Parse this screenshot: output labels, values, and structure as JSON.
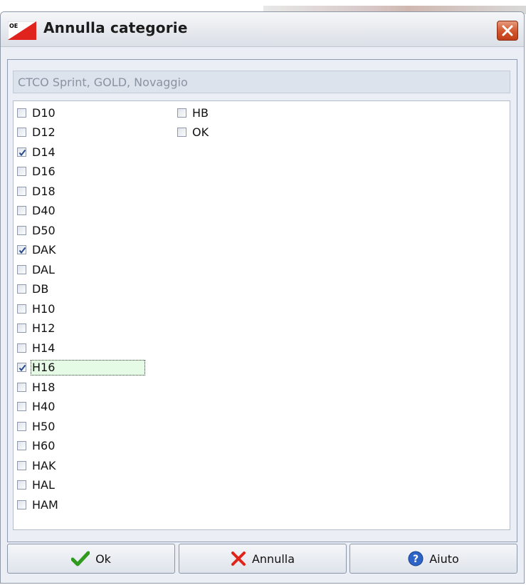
{
  "dialog": {
    "title": "Annulla categorie",
    "header": "CTCO Sprint, GOLD, Novaggio"
  },
  "categories": [
    {
      "label": "D10",
      "checked": false
    },
    {
      "label": "D12",
      "checked": false
    },
    {
      "label": "D14",
      "checked": true
    },
    {
      "label": "D16",
      "checked": false
    },
    {
      "label": "D18",
      "checked": false
    },
    {
      "label": "D40",
      "checked": false
    },
    {
      "label": "D50",
      "checked": false
    },
    {
      "label": "DAK",
      "checked": true
    },
    {
      "label": "DAL",
      "checked": false
    },
    {
      "label": "DB",
      "checked": false
    },
    {
      "label": "H10",
      "checked": false
    },
    {
      "label": "H12",
      "checked": false
    },
    {
      "label": "H14",
      "checked": false
    },
    {
      "label": "H16",
      "checked": true,
      "focused": true
    },
    {
      "label": "H18",
      "checked": false
    },
    {
      "label": "H40",
      "checked": false
    },
    {
      "label": "H50",
      "checked": false
    },
    {
      "label": "H60",
      "checked": false
    },
    {
      "label": "HAK",
      "checked": false
    },
    {
      "label": "HAL",
      "checked": false
    },
    {
      "label": "HAM",
      "checked": false
    },
    {
      "label": "HB",
      "checked": false
    },
    {
      "label": "OK",
      "checked": false
    }
  ],
  "buttons": {
    "ok": "Ok",
    "cancel": "Annulla",
    "help": "Aiuto"
  },
  "icons": {
    "ok": "checkmark-icon",
    "cancel": "cross-icon",
    "help": "help-icon"
  }
}
